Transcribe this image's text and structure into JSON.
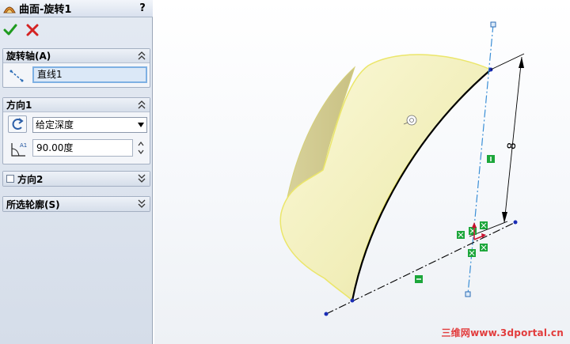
{
  "panel": {
    "title": "曲面-旋转1",
    "help_label": "?",
    "groups": {
      "axis": {
        "header": "旋转轴(A)",
        "selection": "直线1"
      },
      "dir1": {
        "header": "方向1",
        "end_condition": "给定深度",
        "angle": "90.00度"
      },
      "dir2": {
        "header": "方向2",
        "checked": false
      },
      "contours": {
        "header": "所选轮廓(S)"
      }
    }
  },
  "viewport": {
    "dimension_label": "8",
    "watermark": "三维网www.3dportal.cn"
  },
  "colors": {
    "surface_fill": "#f4f1c0",
    "surface_edge": "#e8e57a",
    "sketch_line": "#000000",
    "axis_line": "#3b8fd6",
    "relation_badge": "#1ca63a",
    "watermark": "#e23c3c"
  },
  "icons": {
    "title": "revolve-surface-icon",
    "ok": "checkmark-icon",
    "cancel": "x-icon",
    "axis": "axis-line-icon",
    "reverse": "reverse-direction-icon",
    "angle": "angle-icon"
  }
}
